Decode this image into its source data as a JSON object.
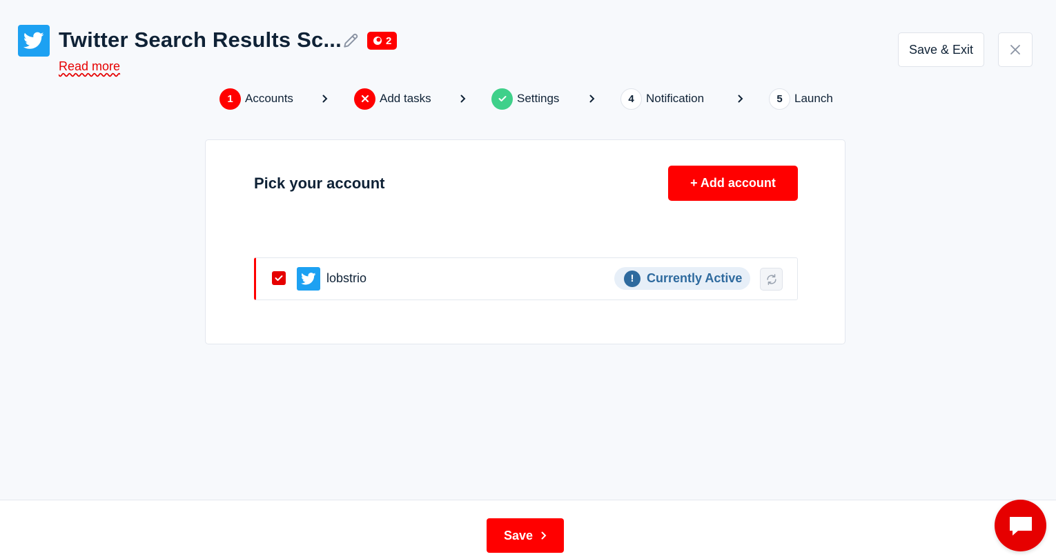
{
  "header": {
    "title": "Twitter Search Results Sc...",
    "badge_count": "2",
    "read_more": "Read more",
    "save_exit_label": "Save & Exit"
  },
  "stepper": {
    "steps": [
      {
        "number": "1",
        "label": "Accounts",
        "state": "active"
      },
      {
        "number": "",
        "label": "Add tasks",
        "state": "error"
      },
      {
        "number": "",
        "label": "Settings",
        "state": "done"
      },
      {
        "number": "4",
        "label": "Notification",
        "state": "idle"
      },
      {
        "number": "5",
        "label": "Launch",
        "state": "idle"
      }
    ]
  },
  "card": {
    "title": "Pick your account",
    "add_account_label": "+ Add account",
    "accounts": [
      {
        "name": "lobstrio",
        "status": "Currently Active",
        "checked": true
      }
    ]
  },
  "footer": {
    "save_label": "Save"
  },
  "icons": {
    "app_logo": "twitter-bird-icon",
    "edit": "pencil-icon",
    "close": "close-icon",
    "refresh": "refresh-icon",
    "chat": "chat-bubble-icon"
  },
  "colors": {
    "accent": "#ff0000",
    "twitter": "#1da1f2",
    "success": "#3fd08a",
    "status_text": "#2e6a9e",
    "status_bg": "#e7eff8"
  }
}
